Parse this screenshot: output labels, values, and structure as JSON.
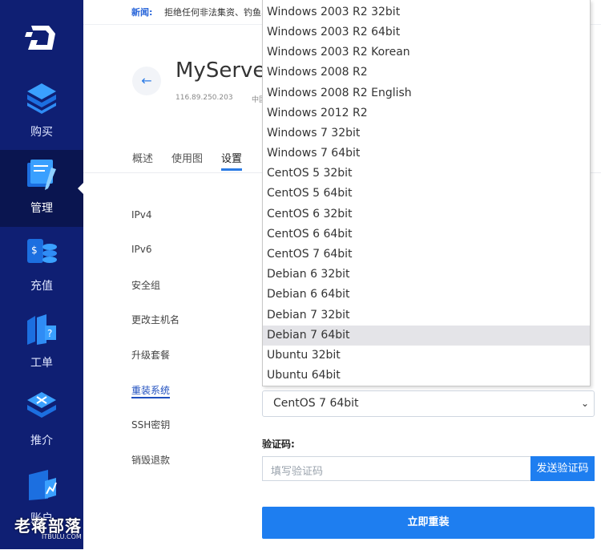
{
  "sidebar": {
    "items": [
      {
        "label": "购买",
        "icon": "cube-icon"
      },
      {
        "label": "管理",
        "icon": "manage-icon"
      },
      {
        "label": "充值",
        "icon": "coins-icon"
      },
      {
        "label": "工单",
        "icon": "ticket-icon"
      },
      {
        "label": "推介",
        "icon": "referral-icon"
      },
      {
        "label": "账户",
        "icon": "account-icon"
      }
    ]
  },
  "notice": {
    "label": "新闻:",
    "text": "拒绝任何非法集资、钓鱼、"
  },
  "server": {
    "name": "MyServer",
    "ip": "116.89.250.203",
    "location": "中国"
  },
  "tabs": [
    "概述",
    "使用图",
    "设置"
  ],
  "settings_menu": [
    "IPv4",
    "IPv6",
    "安全组",
    "更改主机名",
    "升级套餐",
    "重装系统",
    "SSH密钥",
    "销毁退款"
  ],
  "os_select": {
    "value": "CentOS 7 64bit",
    "options": [
      "Windows 2003 R2 32bit",
      "Windows 2003 R2 64bit",
      "Windows 2003 R2 Korean",
      "Windows 2008 R2",
      "Windows 2008 R2 English",
      "Windows 2012 R2",
      "Windows 7 32bit",
      "Windows 7 64bit",
      "CentOS 5 32bit",
      "CentOS 5 64bit",
      "CentOS 6 32bit",
      "CentOS 6 64bit",
      "CentOS 7 64bit",
      "Debian 6 32bit",
      "Debian 6 64bit",
      "Debian 7 32bit",
      "Debian 7 64bit",
      "Ubuntu 32bit",
      "Ubuntu 64bit"
    ],
    "highlighted": "Debian 7 64bit"
  },
  "captcha": {
    "label": "验证码:",
    "placeholder": "填写验证码",
    "send_label": "发送验证码"
  },
  "submit_label": "立即重装",
  "watermark": {
    "text": "老蒋部落",
    "sub": "ITBULU.COM"
  },
  "colors": {
    "sidebar": "#0f1f73",
    "accent": "#1e7ef0"
  }
}
